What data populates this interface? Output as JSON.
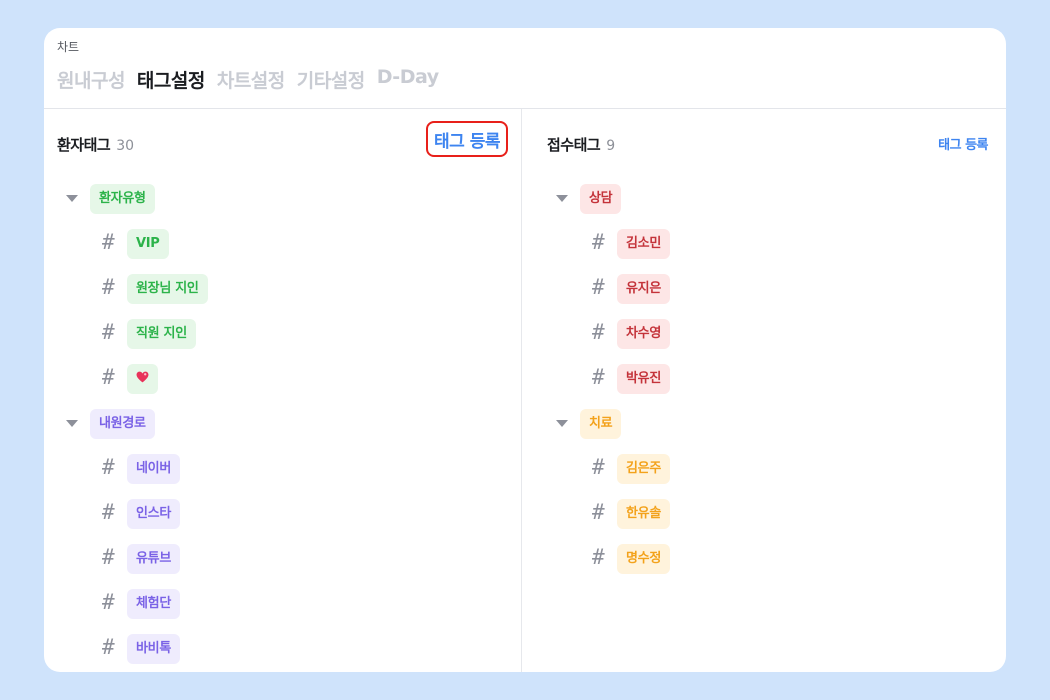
{
  "breadcrumb": "차트",
  "tabs": [
    {
      "label": "원내구성",
      "active": false
    },
    {
      "label": "태그설정",
      "active": true
    },
    {
      "label": "차트설정",
      "active": false
    },
    {
      "label": "기타설정",
      "active": false
    },
    {
      "label": "D-Day",
      "active": false
    }
  ],
  "left_panel": {
    "title": "환자태그",
    "count": "30",
    "register_label": "태그 등록",
    "groups": [
      {
        "label": "환자유형",
        "tags": [
          "VIP",
          "원장님 지인",
          "직원 지인"
        ]
      },
      {
        "label": "내원경로",
        "tags": [
          "네이버",
          "인스타",
          "유튜브",
          "체험단",
          "바비톡"
        ]
      }
    ]
  },
  "right_panel": {
    "title": "접수태그",
    "count": "9",
    "register_label": "태그 등록",
    "groups": [
      {
        "label": "상담",
        "tags": [
          "김소민",
          "유지은",
          "차수영",
          "박유진"
        ]
      },
      {
        "label": "치료",
        "tags": [
          "김은주",
          "한유솔",
          "명수정"
        ]
      }
    ]
  },
  "hash_symbol": "#",
  "icons": {
    "caret": "caret-down-icon",
    "hash": "hash-icon",
    "heart": "heart-icon"
  },
  "colors": {
    "accent": "#3d84f0",
    "highlight_border": "#e8201a",
    "green_text": "#2cb34a",
    "purple_text": "#7a62e6",
    "red_text": "#c4333a",
    "orange_text": "#f3a21b"
  }
}
